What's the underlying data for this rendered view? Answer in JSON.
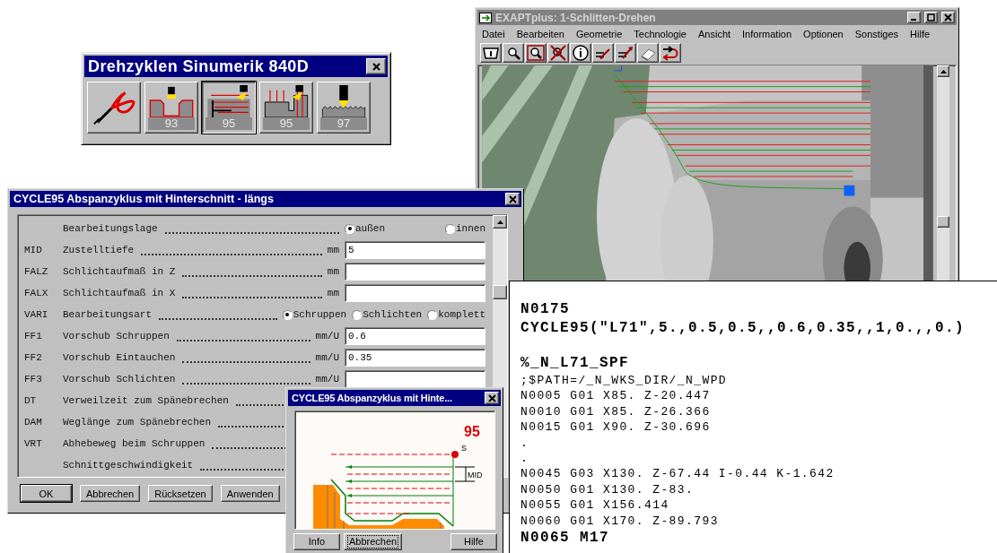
{
  "palette_window": {
    "title": "Drehzyklen Sinumerik 840D",
    "buttons": [
      {
        "kind": "tongs",
        "selected": false
      },
      {
        "kind": "groove",
        "label": "93",
        "selected": false
      },
      {
        "kind": "stock_removal",
        "label": "95",
        "selected": true
      },
      {
        "kind": "undercut",
        "label": "95",
        "selected": false
      },
      {
        "kind": "thread",
        "label": "97",
        "selected": false
      }
    ]
  },
  "cam_window": {
    "title": "EXAPTplus:  1-Schlitten-Drehen",
    "menu": [
      "Datei",
      "Bearbeiten",
      "Geometrie",
      "Technologie",
      "Ansicht",
      "Information",
      "Optionen",
      "Sonstiges",
      "Hilfe"
    ],
    "toolbar": [
      {
        "kind": "panel"
      },
      {
        "kind": "zoom"
      },
      {
        "kind": "zoom_window"
      },
      {
        "kind": "zoom_off"
      },
      {
        "kind": "info"
      },
      {
        "kind": "feed_in"
      },
      {
        "kind": "feed_out"
      },
      {
        "kind": "erase"
      },
      {
        "kind": "return"
      }
    ]
  },
  "cycle_dialog": {
    "title": "CYCLE95 Abspanzyklus mit Hinterschnitt - längs",
    "rows": [
      {
        "kind": "radio",
        "label": "Bearbeitungslage",
        "options": [
          {
            "label": "außen",
            "selected": true
          },
          {
            "label": "innen",
            "selected": false
          }
        ]
      },
      {
        "kind": "field",
        "code": "MID",
        "label": "Zustelltiefe",
        "unit": "mm",
        "value": "5"
      },
      {
        "kind": "field",
        "code": "FALZ",
        "label": "Schlichtaufmaß in Z",
        "unit": "mm"
      },
      {
        "kind": "field",
        "code": "FALX",
        "label": "Schlichtaufmaß in X",
        "unit": "mm"
      },
      {
        "kind": "radio",
        "code": "VARI",
        "label": "Bearbeitungsart",
        "options": [
          {
            "label": "Schruppen",
            "selected": true
          },
          {
            "label": "Schlichten",
            "selected": false
          },
          {
            "label": "komplett",
            "selected": false
          }
        ]
      },
      {
        "kind": "field",
        "code": "FF1",
        "label": "Vorschub Schruppen",
        "unit": "mm/U",
        "value": "0.6"
      },
      {
        "kind": "field",
        "code": "FF2",
        "label": "Vorschub Eintauchen",
        "unit": "mm/U",
        "value": "0.35"
      },
      {
        "kind": "field",
        "code": "FF3",
        "label": "Vorschub Schlichten",
        "unit": "mm/U"
      },
      {
        "kind": "text",
        "code": "DT",
        "label": "Verweilzeit zum Spänebrechen"
      },
      {
        "kind": "text",
        "code": "DAM",
        "label": "Weglänge zum Spänebrechen"
      },
      {
        "kind": "text",
        "code": "VRT",
        "label": "Abhebeweg beim Schruppen"
      },
      {
        "kind": "text",
        "label": "Schnittgeschwindigkeit"
      }
    ],
    "buttons": [
      {
        "label": "OK",
        "default": true
      },
      {
        "label": "Abbrechen",
        "default": false
      },
      {
        "label": "Rücksetzen",
        "default": false
      },
      {
        "label": "Anwenden",
        "default": false
      }
    ]
  },
  "nc_listing": {
    "lines": [
      {
        "kind": "bold",
        "text": "N0175"
      },
      {
        "kind": "bold",
        "text": "CYCLE95(\"L71\",5.,0.5,0.5,,0.6,0.35,,1,0.,,0.)"
      },
      {
        "kind": "section",
        "text": "%_N_L71_SPF"
      },
      {
        "kind": "plain",
        "text": ";$PATH=/_N_WKS_DIR/_N_WPD"
      },
      {
        "kind": "plain",
        "text": "N0005 G01 X85. Z-20.447"
      },
      {
        "kind": "plain",
        "text": "N0010 G01 X85. Z-26.366"
      },
      {
        "kind": "plain",
        "text": "N0015 G01 X90. Z-30.696"
      },
      {
        "kind": "plain",
        "text": "."
      },
      {
        "kind": "plain",
        "text": "."
      },
      {
        "kind": "plain",
        "text": "N0045 G03 X130. Z-67.44 I-0.44 K-1.642"
      },
      {
        "kind": "plain",
        "text": "N0050 G01 X130. Z-83."
      },
      {
        "kind": "plain",
        "text": "N0055 G01 X156.414"
      },
      {
        "kind": "plain",
        "text": "N0060 G01 X170. Z-89.793"
      },
      {
        "kind": "bold",
        "text": "N0065 M17"
      }
    ]
  },
  "preview_dialog": {
    "title": "CYCLE95 Abspanzyklus mit Hinte...",
    "cycle_number": "95",
    "start_label": "S",
    "depth_label": "MID",
    "buttons": [
      {
        "label": "Info",
        "focused": false
      },
      {
        "label": "Abbrechen",
        "focused": true
      },
      {
        "label": "Hilfe",
        "focused": false
      }
    ]
  }
}
